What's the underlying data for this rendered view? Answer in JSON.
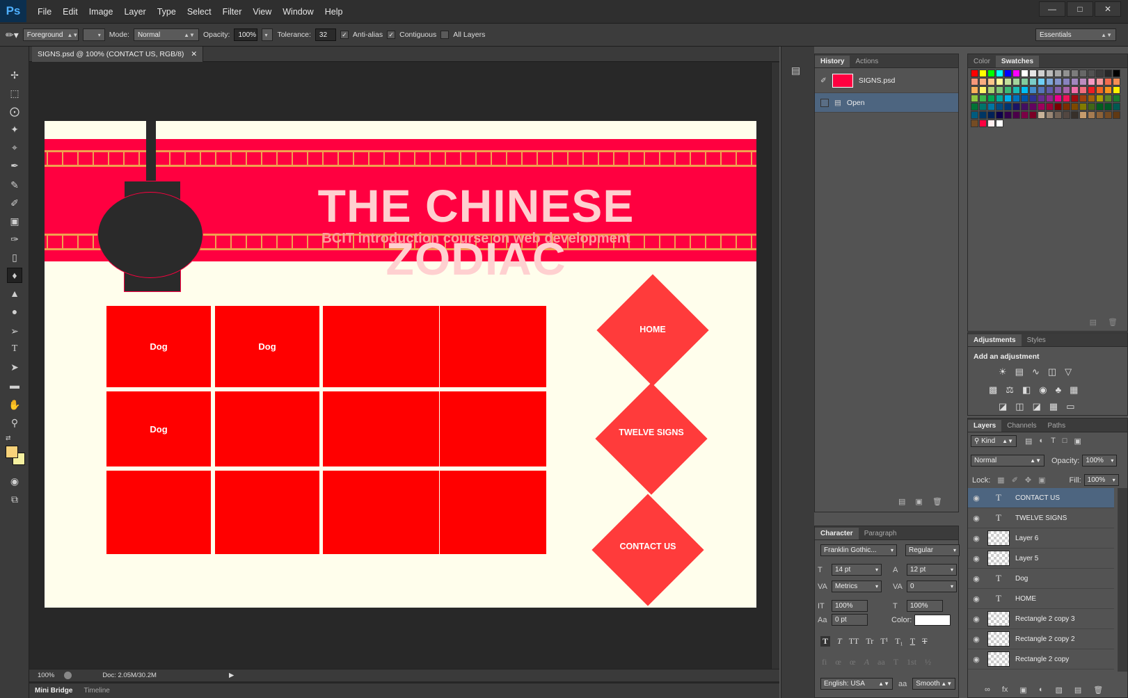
{
  "app": {
    "logo": "Ps",
    "menu": [
      "File",
      "Edit",
      "Image",
      "Layer",
      "Type",
      "Select",
      "Filter",
      "View",
      "Window",
      "Help"
    ]
  },
  "options": {
    "fill_source": "Foreground",
    "mode_label": "Mode:",
    "mode": "Normal",
    "opacity_label": "Opacity:",
    "opacity": "100%",
    "tolerance_label": "Tolerance:",
    "tolerance": "32",
    "antialias": "Anti-alias",
    "contiguous": "Contiguous",
    "all_layers": "All Layers",
    "workspace": "Essentials"
  },
  "document": {
    "tab": "SIGNS.psd @ 100% (CONTACT US, RGB/8)",
    "title": "THE CHINESE ZODIAC",
    "subtitle": "BCIT introduction course on web development",
    "tiles": [
      "Dog",
      "Dog",
      "",
      "",
      "Dog",
      "",
      "",
      "",
      "",
      "",
      "",
      ""
    ],
    "nav": [
      "HOME",
      "TWELVE SIGNS",
      "CONTACT US"
    ]
  },
  "status": {
    "zoom": "100%",
    "doc": "Doc: 2.05M/30.2M"
  },
  "bottom_tabs": [
    "Mini Bridge",
    "Timeline"
  ],
  "history": {
    "tabs": [
      "History",
      "Actions"
    ],
    "snapshot": "SIGNS.psd",
    "items": [
      "Open"
    ]
  },
  "character": {
    "tabs": [
      "Character",
      "Paragraph"
    ],
    "font": "Franklin Gothic...",
    "style": "Regular",
    "size": "14 pt",
    "leading": "12 pt",
    "kerning": "Metrics",
    "tracking": "0",
    "vscale": "100%",
    "hscale": "100%",
    "baseline": "0 pt",
    "color_label": "Color:",
    "language": "English: USA",
    "aa_label": "aa",
    "antialias": "Smooth"
  },
  "swatches": {
    "tabs": [
      "Color",
      "Swatches"
    ],
    "rows": [
      [
        "#ff0000",
        "#ffff00",
        "#00ff00",
        "#00ffff",
        "#0000ff",
        "#ff00ff",
        "#ffffff",
        "#e6e6e6",
        "#d0d0d0",
        "#bbbbbb",
        "#a6a6a6",
        "#919191",
        "#7c7c7c",
        "#676767",
        "#525252",
        "#3c3c3c",
        "#272727",
        "#000000"
      ],
      [
        "#f7977a",
        "#f9ad81",
        "#fdc68a",
        "#fff79a",
        "#c4df9b",
        "#a3d39c",
        "#82ca9d",
        "#7bcdc8",
        "#6ecff6",
        "#7ea7d8",
        "#8493ca",
        "#8882be",
        "#a187be",
        "#bc8dbf",
        "#f49ac2",
        "#f6989d",
        "#f26c4f",
        "#f68e55"
      ],
      [
        "#fbaf5c",
        "#fff467",
        "#acd372",
        "#7cc576",
        "#3bb878",
        "#1abbb4",
        "#00bff3",
        "#438ccb",
        "#5574b9",
        "#605ca8",
        "#855fa8",
        "#a763a8",
        "#f06ea9",
        "#f26d7d",
        "#ed1c24",
        "#f26522",
        "#f7941d",
        "#fff200"
      ],
      [
        "#8dc73f",
        "#39b54a",
        "#00a651",
        "#00a99d",
        "#00aeef",
        "#0072bc",
        "#0054a6",
        "#2e3192",
        "#662d91",
        "#92278f",
        "#ec008c",
        "#ed145b",
        "#9e0b0f",
        "#a0410d",
        "#a36209",
        "#aba000",
        "#598527",
        "#197b30"
      ],
      [
        "#007236",
        "#00746b",
        "#0076a3",
        "#004b80",
        "#003471",
        "#1b1464",
        "#440e62",
        "#630460",
        "#9e005d",
        "#9e0039",
        "#790000",
        "#7b2e00",
        "#7d4900",
        "#827b00",
        "#406618",
        "#005e20",
        "#005826",
        "#005952"
      ],
      [
        "#005b7f",
        "#003663",
        "#002157",
        "#0d004c",
        "#32004b",
        "#4b0049",
        "#7b0046",
        "#7a0026",
        "#c7b299",
        "#998675",
        "#736357",
        "#534741",
        "#37302a",
        "#c69c6d",
        "#a67c52",
        "#8c6239",
        "#754c24",
        "#603913"
      ],
      [
        "#754c24",
        "#ff0040",
        "#ffeeee",
        "#ffffff"
      ]
    ]
  },
  "adjustments": {
    "tabs": [
      "Adjustments",
      "Styles"
    ],
    "heading": "Add an adjustment"
  },
  "layers": {
    "tabs": [
      "Layers",
      "Channels",
      "Paths"
    ],
    "kind": "Kind",
    "blend": "Normal",
    "opacity_label": "Opacity:",
    "opacity": "100%",
    "lock_label": "Lock:",
    "fill_label": "Fill:",
    "fill": "100%",
    "items": [
      {
        "name": "CONTACT US",
        "type": "text",
        "selected": true
      },
      {
        "name": "TWELVE SIGNS",
        "type": "text"
      },
      {
        "name": "Layer 6",
        "type": "raster"
      },
      {
        "name": "Layer 5",
        "type": "raster"
      },
      {
        "name": "Dog",
        "type": "text"
      },
      {
        "name": "HOME",
        "type": "text"
      },
      {
        "name": "Rectangle 2 copy 3",
        "type": "raster"
      },
      {
        "name": "Rectangle 2 copy 2",
        "type": "raster"
      },
      {
        "name": "Rectangle 2 copy",
        "type": "raster"
      }
    ]
  }
}
